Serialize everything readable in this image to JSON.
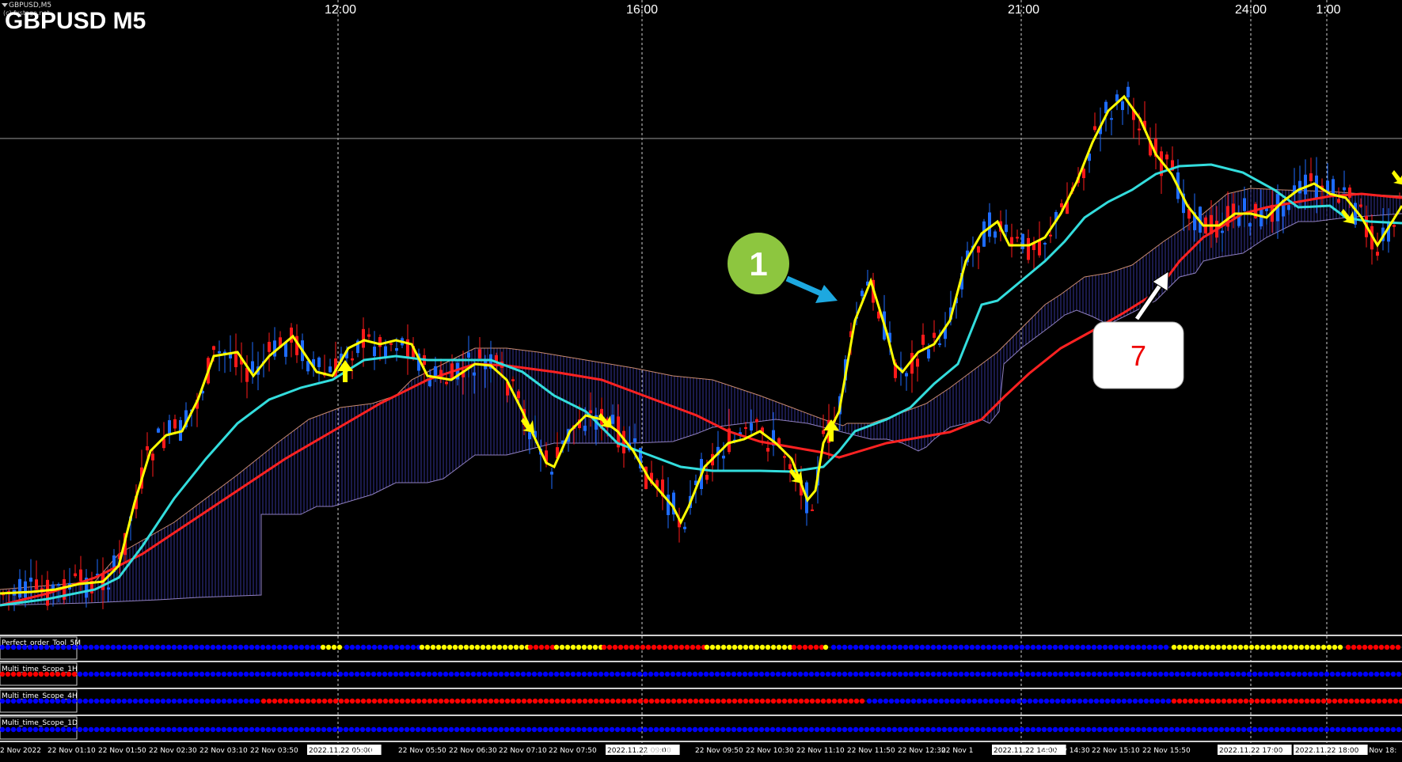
{
  "window": {
    "symbol_small": "GBPUSD,M5",
    "copyright": "(c) fxstage.net",
    "symbol_title": "GBPUSD M5"
  },
  "top_time_labels": [
    "12:00",
    "16:00",
    "21:00",
    "24:00",
    "1:00"
  ],
  "annotations": {
    "marker_1": "1",
    "marker_7": "7"
  },
  "indicator_panes": [
    {
      "name": "Perfect_order_Tool_5M"
    },
    {
      "name": "Multi_time_Scope_1H"
    },
    {
      "name": "Multi_time_Scope_4H"
    },
    {
      "name": "Multi_time_Scope_1D"
    }
  ],
  "bottom_time_labels": [
    "2 Nov 2022",
    "22 Nov 01:10",
    "22 Nov 01:50",
    "22 Nov 02:30",
    "22 Nov 03:10",
    "22 Nov 03:50",
    "2022.11.22 05:00",
    "v 05:10",
    "22 Nov 05:50",
    "22 Nov 06:30",
    "22 Nov 07:10",
    "22 Nov 07:50",
    "2022.11.22 09:00",
    "v 09:10",
    "22 Nov 09:50",
    "22 Nov 10:30",
    "22 Nov 11:10",
    "22 Nov 11:50",
    "22 Nov 12:30",
    "22 Nov 1",
    "2022.11.22 14:00",
    "22 Nov 14:30",
    "22 Nov 15:10",
    "22 Nov 15:50",
    "2022.11.22 17:00",
    "v 1",
    "2022.11.22 18:00",
    "22 Nov 18:"
  ],
  "colors": {
    "background": "#000000",
    "bull": "#1e6cff",
    "bear": "#ff1a1a",
    "ma_fast": "#ffff00",
    "ma_mid": "#33dddd",
    "ma_slow": "#ff2222",
    "cloud_up": "#3f3fb0",
    "cloud_down": "#b05a3a",
    "dot_blue": "#0000ff",
    "dot_red": "#ff0000",
    "dot_yellow": "#ffff00",
    "marker_1_fill": "#8dc63f",
    "arrow_1": "#1da8e0"
  }
}
